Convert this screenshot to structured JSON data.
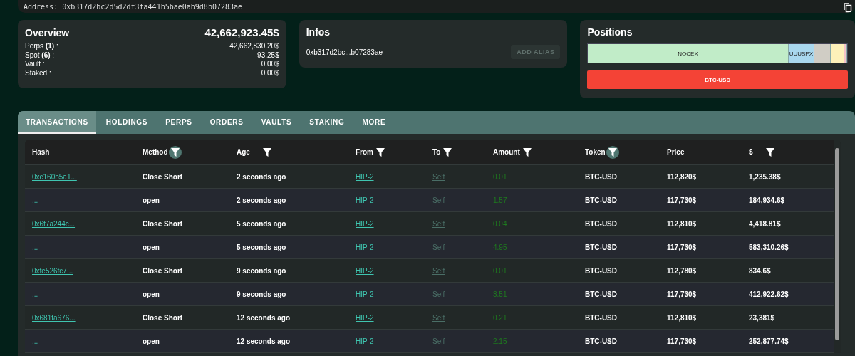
{
  "address_bar": {
    "label": "Address:",
    "value": "0xb317d2bc2d5d2df3fa441b5bae0ab9d8b07283ae"
  },
  "overview": {
    "title": "Overview",
    "total": "42,662,923.45$",
    "lines": [
      {
        "label": "Perps **(1)** :",
        "value": "42,662,830.20$"
      },
      {
        "label": "Spot **(6)** :",
        "value": "93.25$"
      },
      {
        "label": "Vault :",
        "value": "0.00$"
      },
      {
        "label": "Staked :",
        "value": "0.00$"
      }
    ]
  },
  "infos": {
    "title": "Infos",
    "address": "0xb317d2bc...b07283ae",
    "button": "ADD ALIAS"
  },
  "positions": {
    "title": "Positions",
    "segments": [
      {
        "kind": "main",
        "label": "NOCEX",
        "color": "#c1ecc8"
      },
      {
        "kind": "labeled",
        "label": "UUUSPX",
        "color": "#a9d8ee"
      },
      {
        "kind": "blank",
        "color": "#d0cdc5"
      },
      {
        "kind": "small",
        "color": "#fdf1b9"
      },
      {
        "kind": "sliver",
        "color": "#f3c3c8"
      }
    ],
    "bar": {
      "label": "BTC-USD",
      "color": "#f44336"
    }
  },
  "tabs": [
    {
      "label": "TRANSACTIONS",
      "selected": true
    },
    {
      "label": "HOLDINGS",
      "selected": false
    },
    {
      "label": "PERPS",
      "selected": false
    },
    {
      "label": "ORDERS",
      "selected": false
    },
    {
      "label": "VAULTS",
      "selected": false
    },
    {
      "label": "STAKING",
      "selected": false
    },
    {
      "label": "MORE",
      "selected": false
    }
  ],
  "table": {
    "columns": [
      {
        "label": "Hash",
        "filter": false
      },
      {
        "label": "Method",
        "filter": true,
        "filter_active": true
      },
      {
        "label": "Age",
        "filter": true,
        "filter_active": false
      },
      {
        "label": "From",
        "filter": true,
        "filter_active": false
      },
      {
        "label": "To",
        "filter": true,
        "filter_active": false
      },
      {
        "label": "Amount",
        "filter": true,
        "filter_active": false
      },
      {
        "label": "Token",
        "filter": true,
        "filter_active": true
      },
      {
        "label": "Price",
        "filter": false
      },
      {
        "label": "$",
        "filter": true,
        "filter_active": false
      }
    ],
    "rows": [
      {
        "hash": "0xc160b5a1...",
        "method": "Close Short",
        "age": "2 seconds ago",
        "from": "HIP-2",
        "to": "Self",
        "amount": "0.01",
        "token": "BTC-USD",
        "price": "112,820$",
        "usd": "1,235.38$"
      },
      {
        "hash": "...",
        "method": "open",
        "age": "2 seconds ago",
        "from": "HIP-2",
        "to": "Self",
        "amount": "1.57",
        "token": "BTC-USD",
        "price": "117,730$",
        "usd": "184,934.6$"
      },
      {
        "hash": "0x6f7a244c...",
        "method": "Close Short",
        "age": "5 seconds ago",
        "from": "HIP-2",
        "to": "Self",
        "amount": "0.04",
        "token": "BTC-USD",
        "price": "112,810$",
        "usd": "4,418.81$"
      },
      {
        "hash": "...",
        "method": "open",
        "age": "5 seconds ago",
        "from": "HIP-2",
        "to": "Self",
        "amount": "4.95",
        "token": "BTC-USD",
        "price": "117,730$",
        "usd": "583,310.26$"
      },
      {
        "hash": "0xfe526fc7...",
        "method": "Close Short",
        "age": "9 seconds ago",
        "from": "HIP-2",
        "to": "Self",
        "amount": "0.01",
        "token": "BTC-USD",
        "price": "112,780$",
        "usd": "834.6$"
      },
      {
        "hash": "...",
        "method": "open",
        "age": "9 seconds ago",
        "from": "HIP-2",
        "to": "Self",
        "amount": "3.51",
        "token": "BTC-USD",
        "price": "117,730$",
        "usd": "412,922.62$"
      },
      {
        "hash": "0x681fa676...",
        "method": "Close Short",
        "age": "12 seconds ago",
        "from": "HIP-2",
        "to": "Self",
        "amount": "0.21",
        "token": "BTC-USD",
        "price": "112,810$",
        "usd": "23,381$"
      },
      {
        "hash": "...",
        "method": "open",
        "age": "12 seconds ago",
        "from": "HIP-2",
        "to": "Self",
        "amount": "2.15",
        "token": "BTC-USD",
        "price": "117,730$",
        "usd": "252,877.74$"
      }
    ]
  }
}
